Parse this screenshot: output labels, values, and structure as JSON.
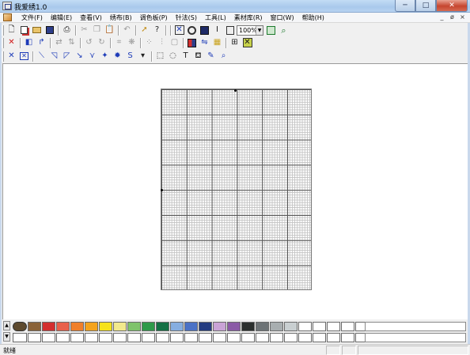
{
  "window": {
    "title": "我爱绣1.0",
    "caption_min": "─",
    "caption_max": "□",
    "caption_close": "✕"
  },
  "menubar": {
    "items": [
      "文件(F)",
      "编辑(E)",
      "查看(V)",
      "绣布(B)",
      "调色板(P)",
      "针法(S)",
      "工具(L)",
      "素材库(R)",
      "窗口(W)",
      "帮助(H)"
    ],
    "mdi_min": "_",
    "mdi_restore": "ø",
    "mdi_close": "×"
  },
  "toolbar1": {
    "zoom_value": "100%",
    "text_tool_label": "I"
  },
  "toolbar3": {
    "text_tool_label": "T",
    "s_tool_label": "S"
  },
  "palette": {
    "current_color": "#5e4a2e",
    "colors": [
      "#8a6238",
      "#d32f2f",
      "#e8604a",
      "#f07f2a",
      "#f4a31c",
      "#f6e21a",
      "#f2e98c",
      "#7fc36b",
      "#2e9a4a",
      "#137044",
      "#86aee0",
      "#4b72c6",
      "#233b80",
      "#c9a3d6",
      "#8a5aa6",
      "#2b2f2e",
      "#6d7376",
      "#a8aeb0",
      "#c9cfd1",
      "#ffffff",
      "#ffffff",
      "#ffffff",
      "#ffffff",
      "#ffffff",
      "#ffffff"
    ],
    "empty_row_count_label": ""
  },
  "status": {
    "text": "就绪"
  }
}
